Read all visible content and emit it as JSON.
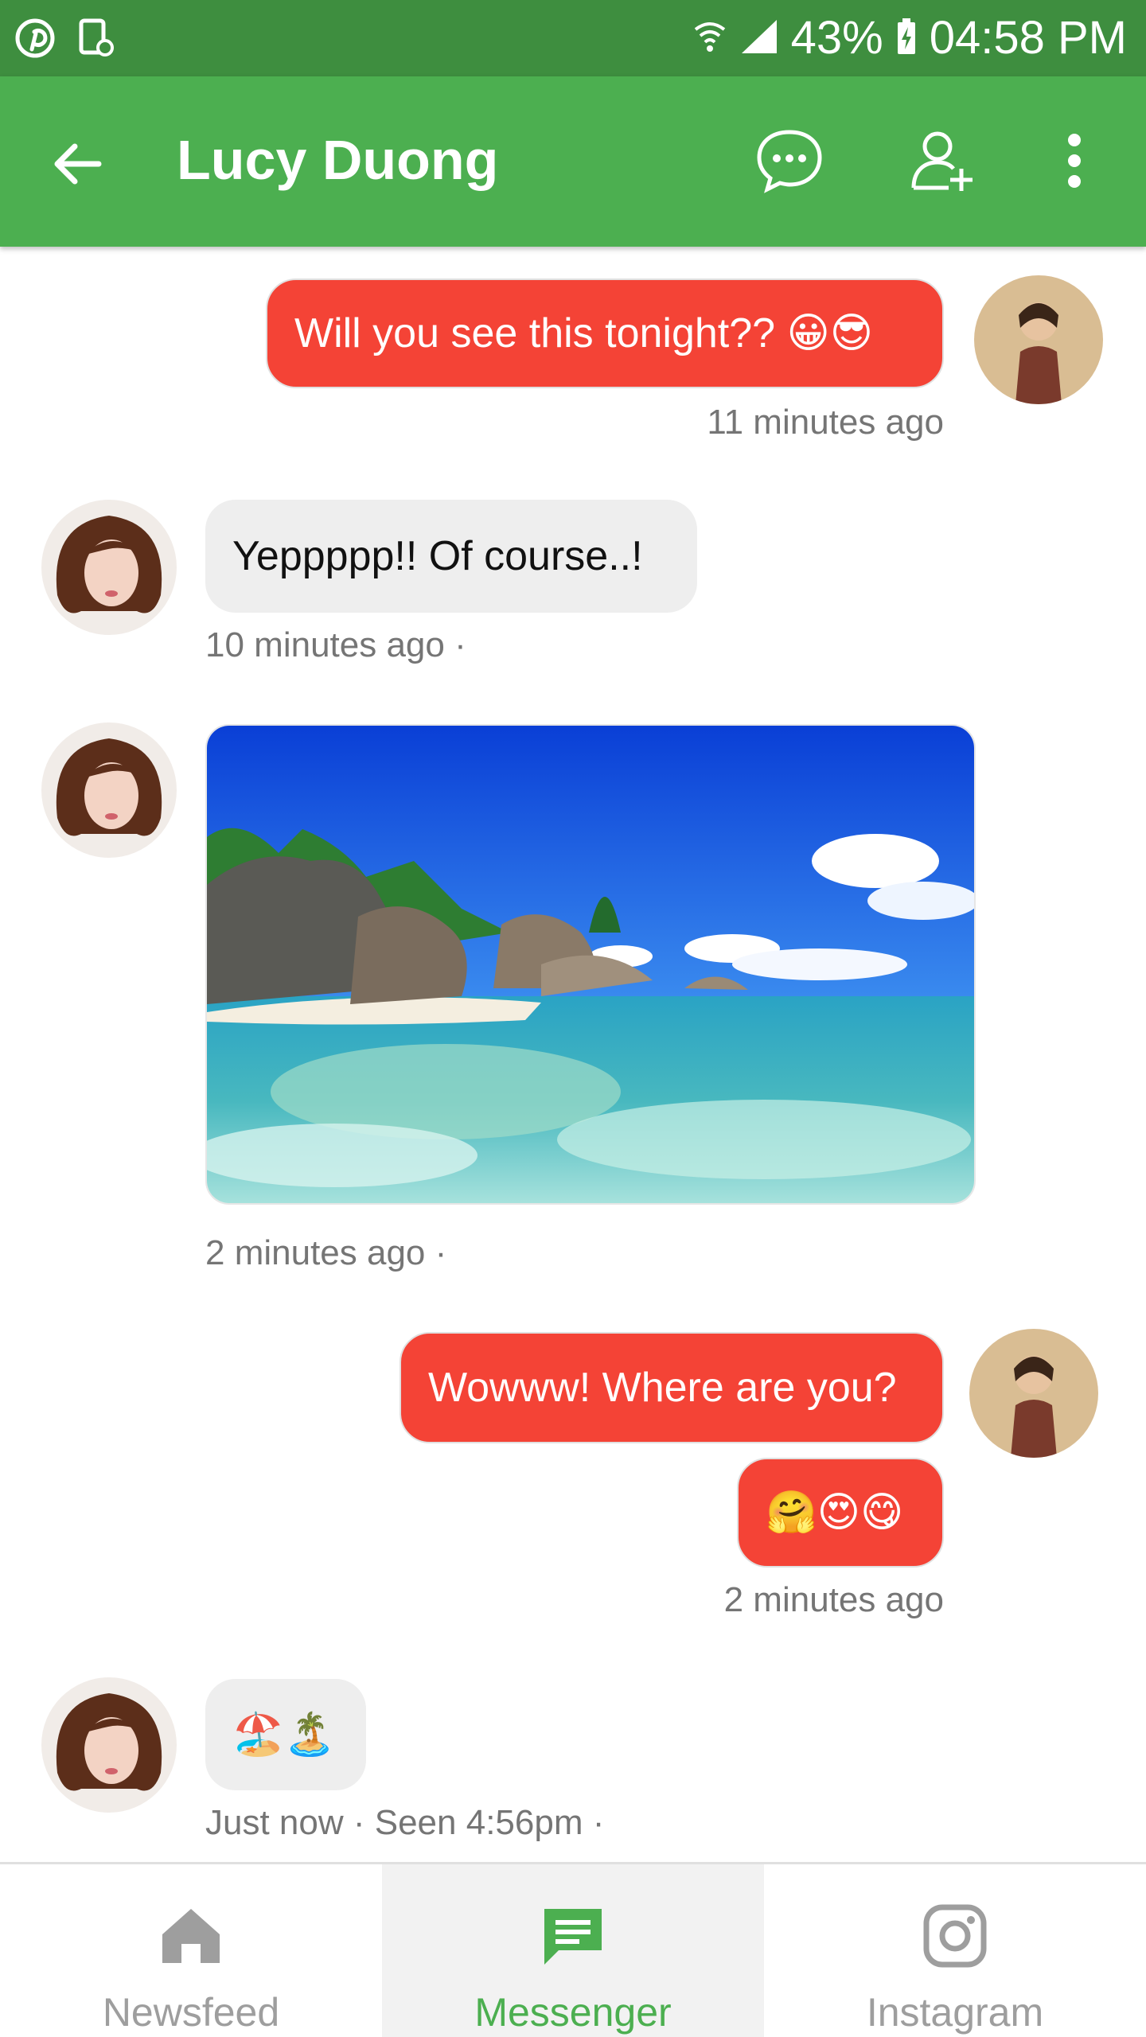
{
  "status_bar": {
    "battery": "43%",
    "time": "04:58 PM",
    "icons": [
      "pinterest-icon",
      "phone-doc-icon",
      "wifi-icon",
      "signal-icon",
      "battery-charging-icon"
    ]
  },
  "header": {
    "title": "Lucy Duong",
    "icons": [
      "back-arrow-icon",
      "chat-bubble-icon",
      "add-user-icon",
      "more-vert-icon"
    ]
  },
  "messages": [
    {
      "sender": "me",
      "text": "Will you see this tonight?? 😀😎",
      "meta": "11 minutes ago"
    },
    {
      "sender": "them",
      "text": "Yeppppp!! Of course..!",
      "meta": "10 minutes ago ·"
    },
    {
      "sender": "them",
      "type": "image",
      "alt": "tropical beach photo",
      "meta": "2 minutes ago ·"
    },
    {
      "sender": "me",
      "text": "Wowww! Where are you?"
    },
    {
      "sender": "me",
      "text": "🤗😍😋",
      "meta": "2 minutes ago"
    },
    {
      "sender": "them",
      "text": "🏖️🏝️",
      "meta": "Just now · Seen 4:56pm ·"
    }
  ],
  "bottom_nav": {
    "items": [
      {
        "label": "Newsfeed",
        "icon": "home-icon",
        "active": false
      },
      {
        "label": "Messenger",
        "icon": "message-icon",
        "active": true
      },
      {
        "label": "Instagram",
        "icon": "instagram-icon",
        "active": false
      }
    ]
  },
  "colors": {
    "status_bar": "#3e8e3f",
    "app_bar": "#4caf50",
    "my_bubble": "#f44336",
    "their_bubble": "#eeeeee",
    "active_nav": "#4caf50",
    "inactive_nav": "#9e9e9e"
  }
}
